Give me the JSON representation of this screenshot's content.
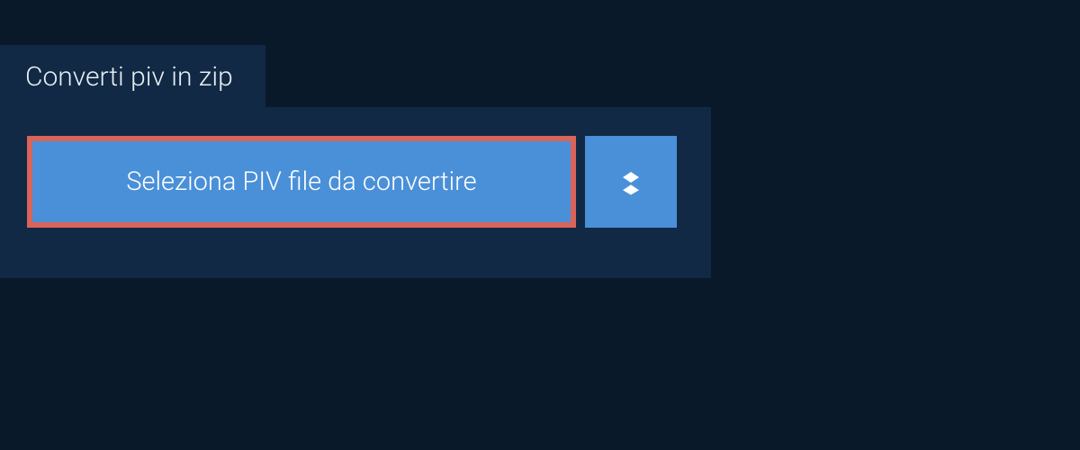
{
  "tab": {
    "title": "Converti piv in zip"
  },
  "main": {
    "select_button_label": "Seleziona PIV file da convertire",
    "dropbox_icon": "dropbox-icon"
  },
  "colors": {
    "background": "#0a1929",
    "panel": "#112944",
    "button": "#4a90d9",
    "highlight_border": "#d96459",
    "text_light": "#e8eef4",
    "text_white": "#ffffff"
  }
}
